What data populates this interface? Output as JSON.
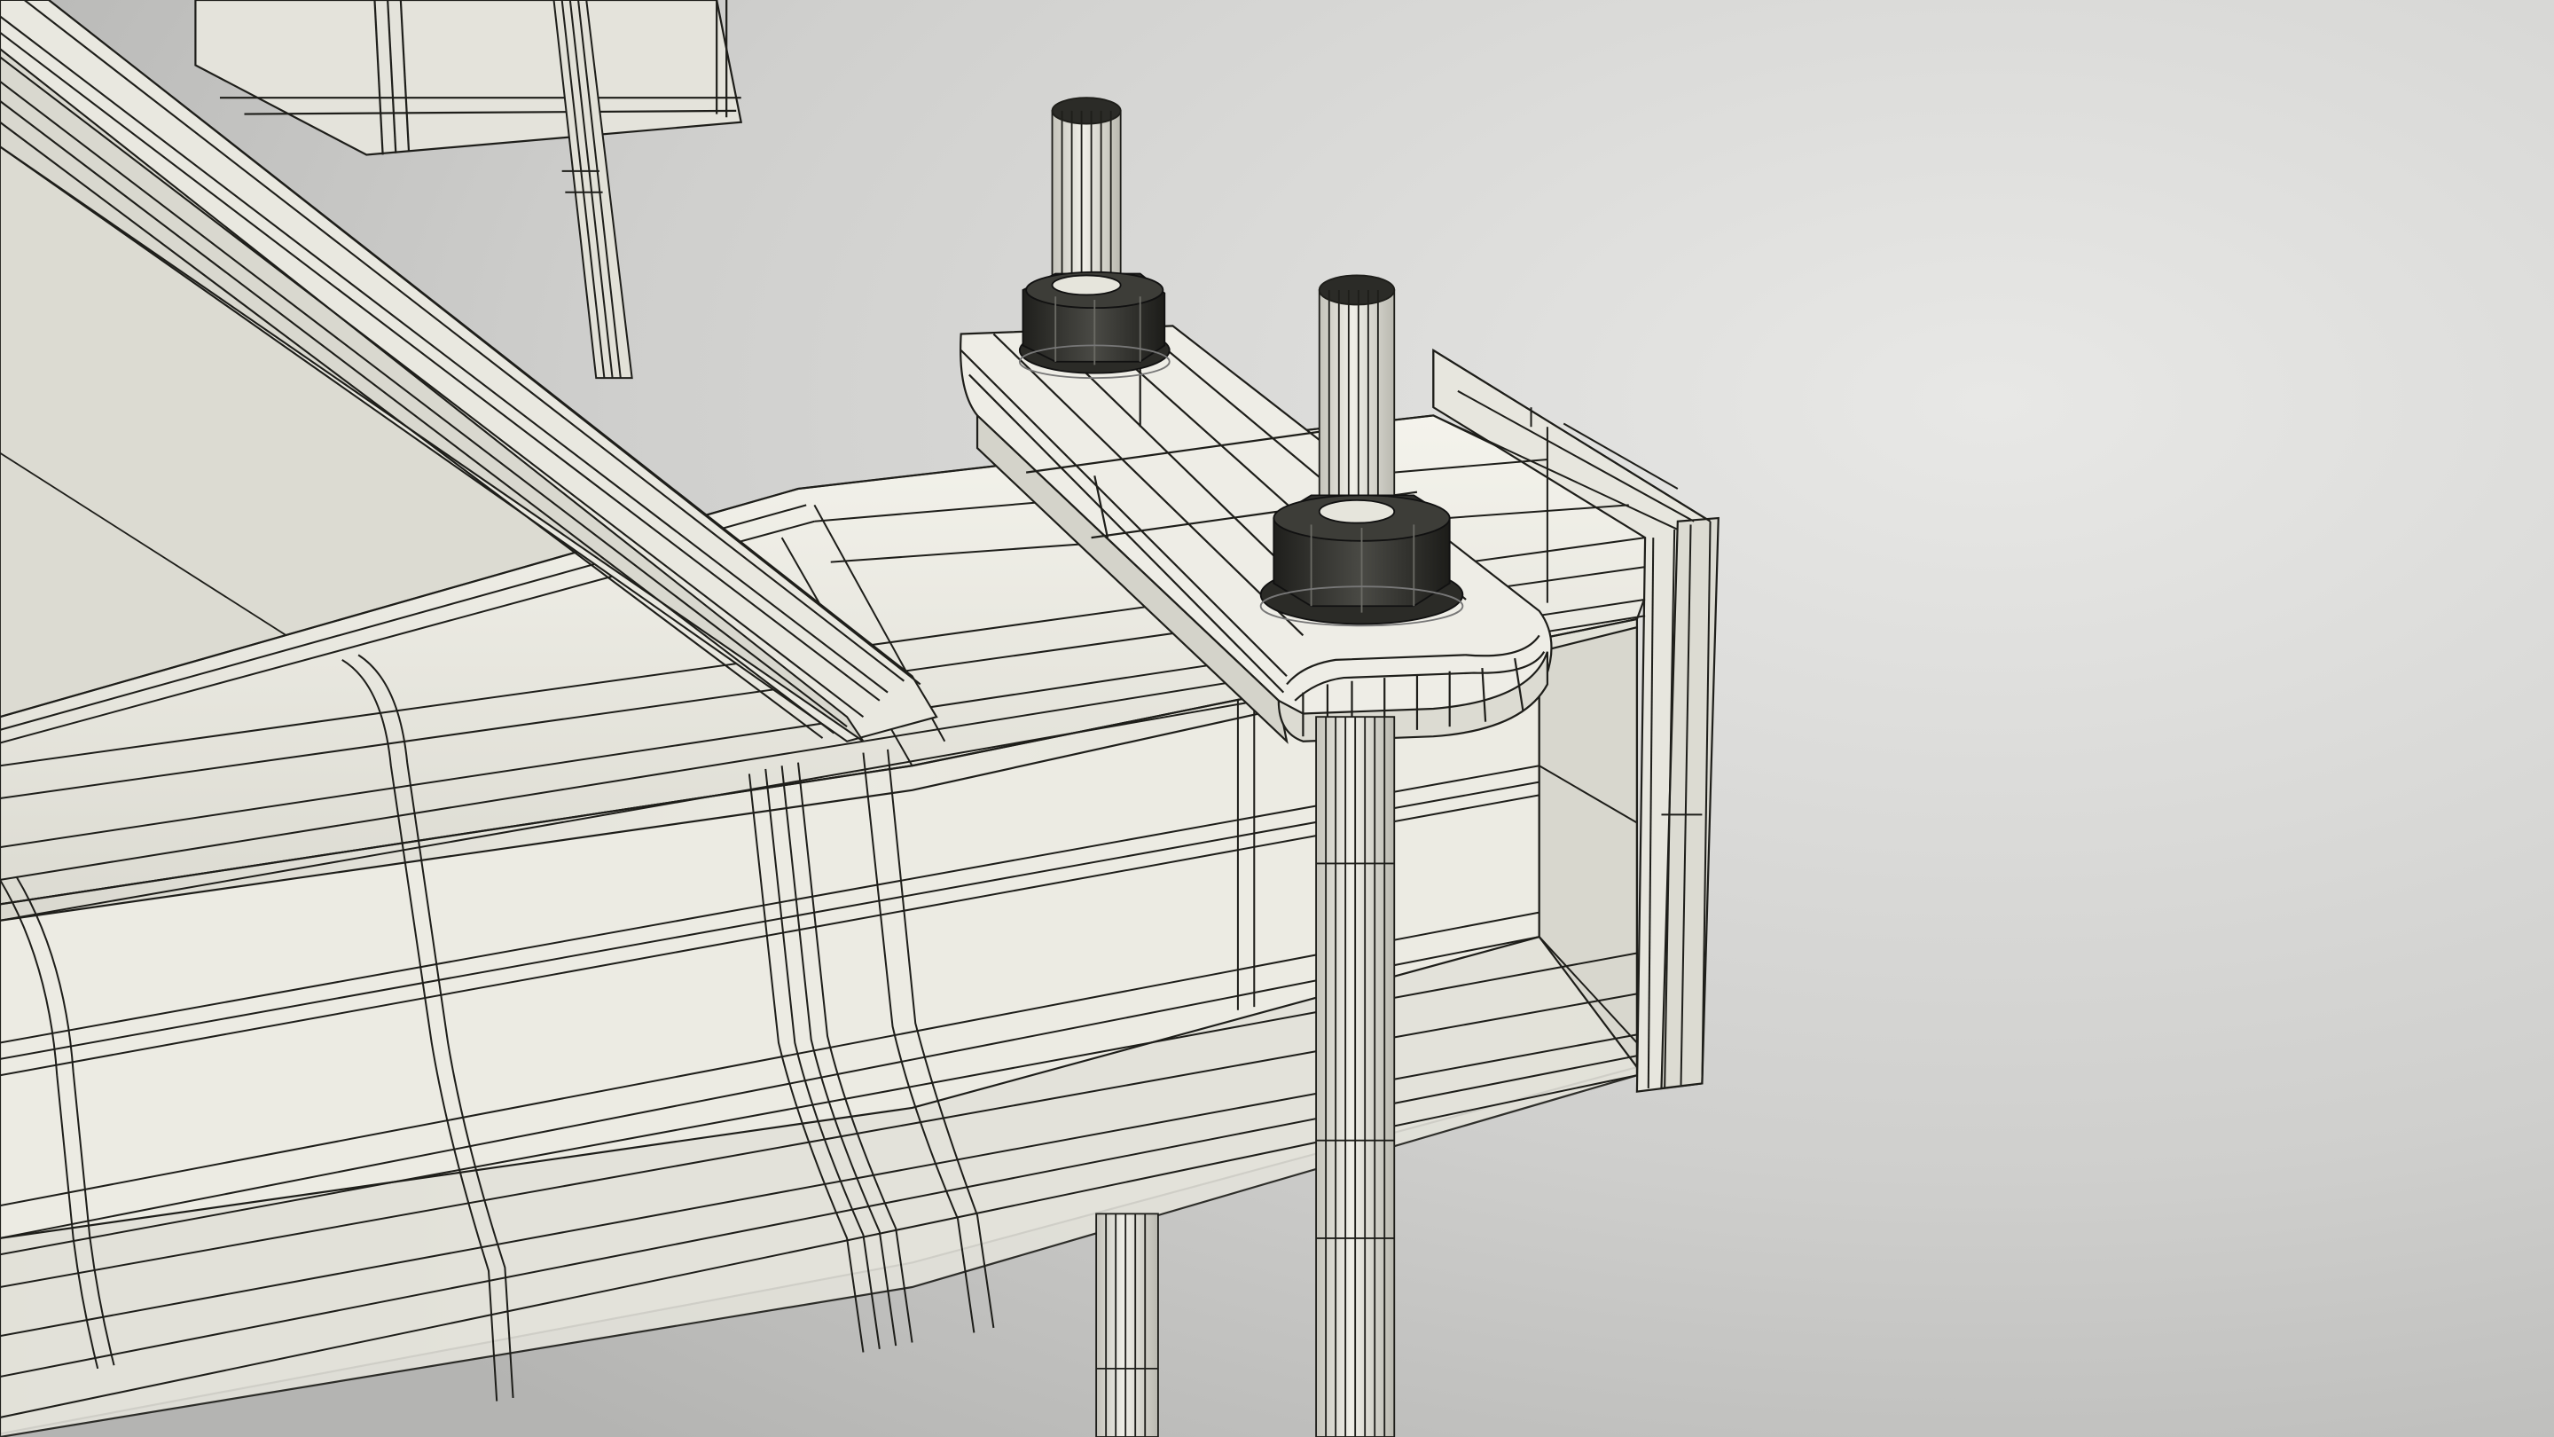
{
  "scene": {
    "subject": "wireframe-3d-render",
    "colors": {
      "background_light": "#e6e6e4",
      "background_dark": "#b8b8b6",
      "surface": "#ecebe3",
      "surface_shadow": "#d3d2c9",
      "surface_dark": "#bdbcb3",
      "wire": "#1e1e1a",
      "nut": "#2b2b27",
      "nut_highlight": "#565650"
    },
    "objects": [
      {
        "name": "upper-rail",
        "icon": "rail"
      },
      {
        "name": "diagonal-brace",
        "icon": "brace"
      },
      {
        "name": "main-beam",
        "icon": "i-beam"
      },
      {
        "name": "clamp-plate",
        "icon": "plate"
      },
      {
        "name": "bolt-back",
        "icon": "threaded-rod"
      },
      {
        "name": "bolt-front",
        "icon": "threaded-rod"
      },
      {
        "name": "hex-nut-back",
        "icon": "hex-nut"
      },
      {
        "name": "hex-nut-front",
        "icon": "hex-nut"
      },
      {
        "name": "lower-rod",
        "icon": "rod"
      }
    ]
  }
}
